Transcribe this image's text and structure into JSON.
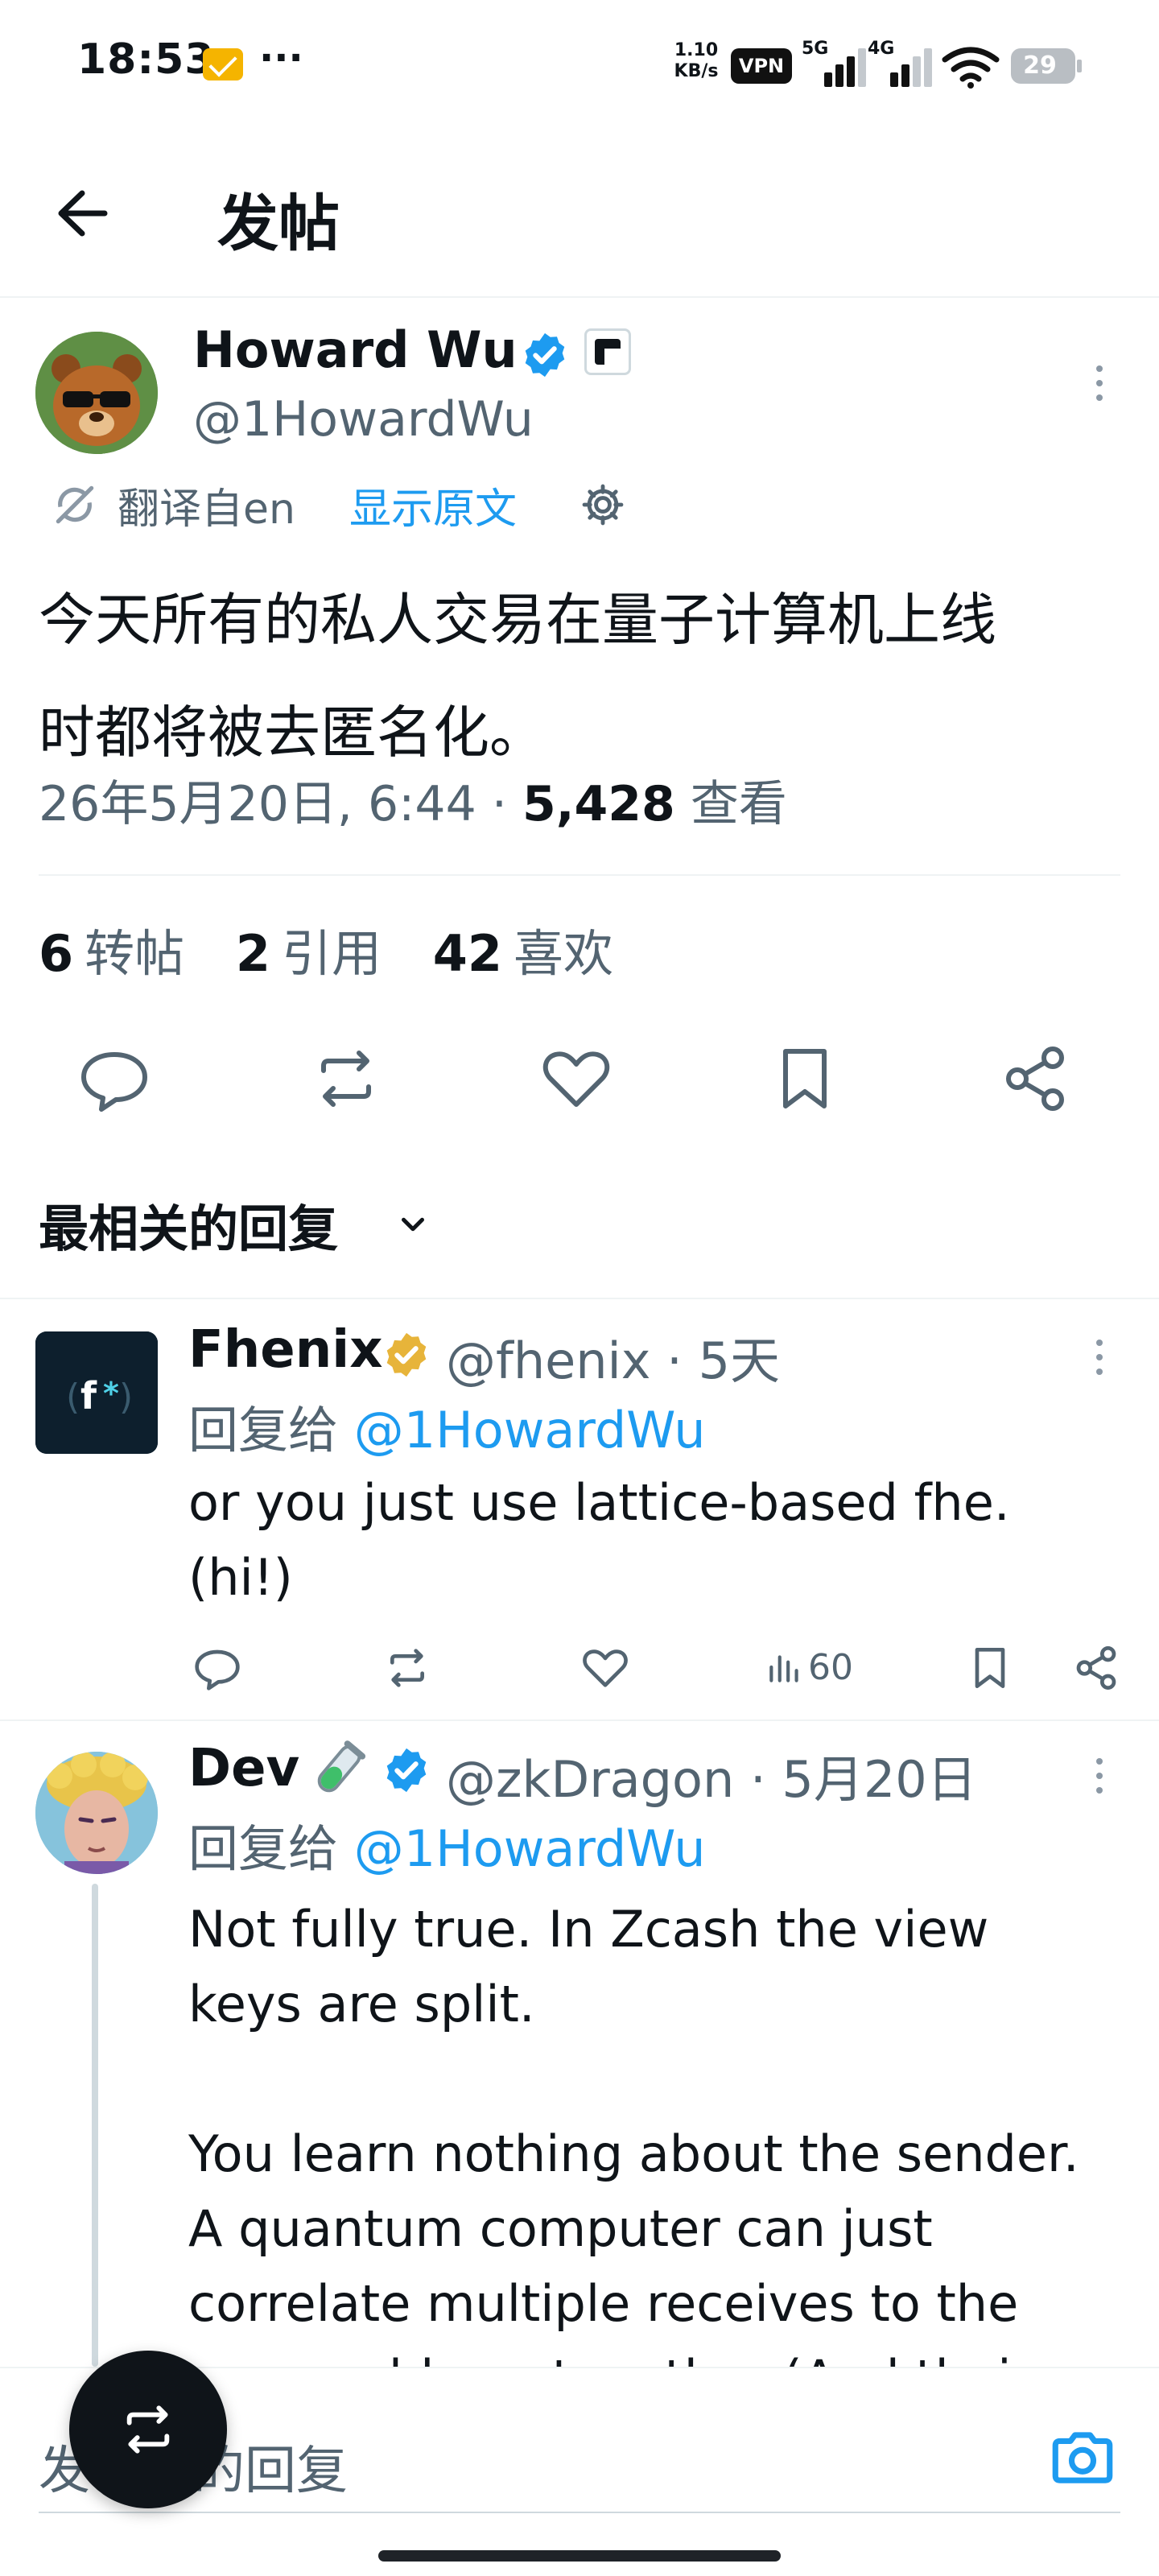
{
  "status_bar": {
    "time": "18:53",
    "dots": "···",
    "net_speed_value": "1.10",
    "net_speed_unit": "KB/s",
    "vpn": "VPN",
    "signal_1": "5G",
    "signal_2": "4G",
    "battery": "29"
  },
  "header": {
    "title": "发帖"
  },
  "tweet": {
    "author_name": "Howard Wu",
    "author_handle": "@1HowardWu",
    "translate_label": "翻译自en",
    "show_original": "显示原文",
    "text_line_1": "今天所有的私人交易在量子计算机上线",
    "text_line_2": "时都将被去匿名化。",
    "timestamp": "26年5月20日, 6:44 · ",
    "views_count": "5,428",
    "views_label": " 查看",
    "stats": {
      "reposts_count": "6",
      "reposts_label": "转帖",
      "quotes_count": "2",
      "quotes_label": "引用",
      "likes_count": "42",
      "likes_label": "喜欢"
    }
  },
  "replies_sort": {
    "label": "最相关的回复"
  },
  "replies": [
    {
      "name": "Fhenix",
      "handle_time": "@fhenix · 5天",
      "reply_to_prefix": "回复给 ",
      "reply_to_handle": "@1HowardWu",
      "text": "or you just use lattice-based fhe.\n(hi!)",
      "views": "60"
    },
    {
      "name": "Dev",
      "handle_time": "@zkDragon · 5月20日",
      "reply_to_prefix": "回复给 ",
      "reply_to_handle": "@1HowardWu",
      "text": "Not fully true. In Zcash the view\nkeys are split.\n\nYou learn nothing about the sender.\nA quantum computer can just\ncorrelate multiple receives to the\nsame address together (And their"
    }
  ],
  "composer": {
    "placeholder": "发布你的回复"
  },
  "colors": {
    "accent": "#1d9bf0",
    "gold_badge": "#e7b43a",
    "text": "#0f1419",
    "muted": "#536471"
  }
}
